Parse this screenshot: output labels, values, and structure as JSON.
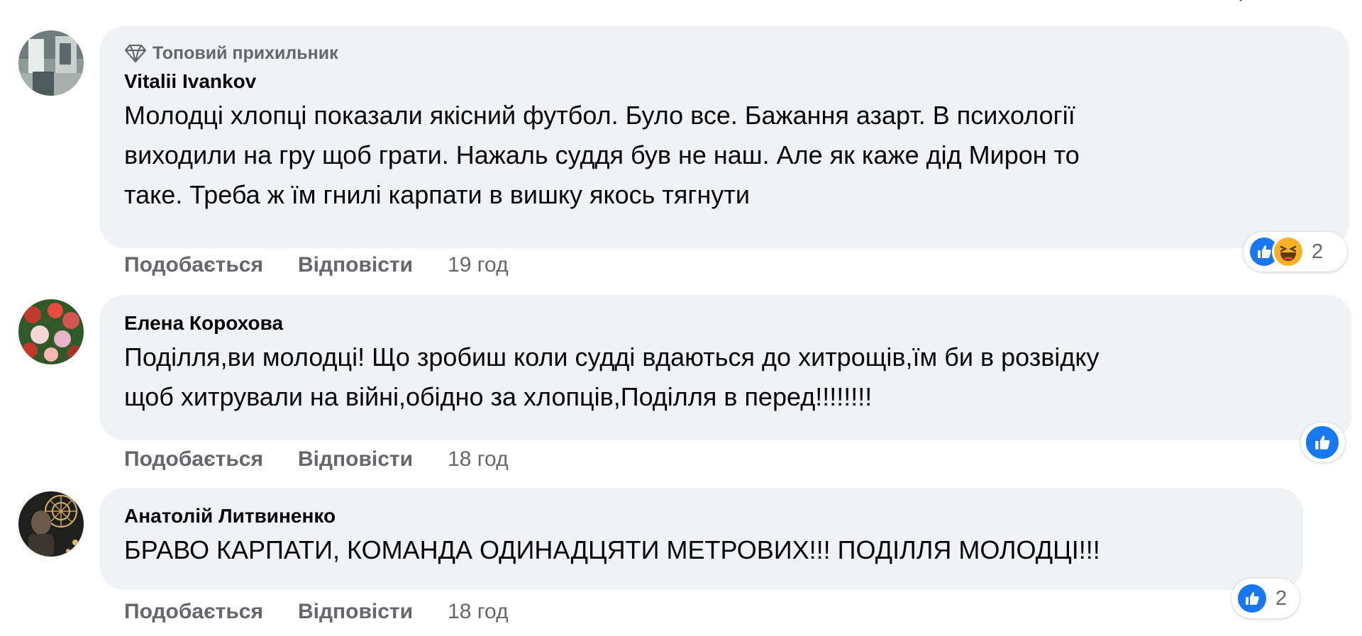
{
  "colors": {
    "bubble_bg": "#f0f2f5",
    "secondary_text": "#65676b",
    "like_blue": "#1877f2",
    "haha_yellow": "#f7b125"
  },
  "comments": [
    {
      "badge_icon": "diamond-icon",
      "badge_label": "Топовий прихильник",
      "author": "Vitalii Ivankov",
      "lines": [
        "Молодці хлопці показали якісний футбол. Було все. Бажання азарт. В психології",
        "виходили на гру щоб грати. Нажаль суддя був не наш. Але як каже дід Мирон то",
        "таке. Треба ж їм гнилі карпати в вишку якось тягнути"
      ],
      "like_label": "Подобається",
      "reply_label": "Відповісти",
      "time": "19 год",
      "reactions": [
        "like-icon",
        "haha-icon"
      ],
      "reaction_count": "2"
    },
    {
      "author": "Елена Корохова",
      "lines": [
        "Поділля,ви молодці! Що зробиш коли судді вдаються до хитрощів,їм би в розвідку",
        "щоб хитрували на війні,обідно за хлопців,Поділля в перед!!!!!!!!"
      ],
      "like_label": "Подобається",
      "reply_label": "Відповісти",
      "time": "18 год",
      "reactions": [
        "like-icon"
      ]
    },
    {
      "author": "Анатолій Литвиненко",
      "lines": [
        "БРАВО КАРПАТИ, КОМАНДА ОДИНАДЦЯТИ МЕТРОВИХ!!! ПОДІЛЛЯ МОЛОДЦІ!!!"
      ],
      "like_label": "Подобається",
      "reply_label": "Відповісти",
      "time": "18 год",
      "reactions": [
        "like-icon"
      ],
      "reaction_count": "2"
    }
  ]
}
